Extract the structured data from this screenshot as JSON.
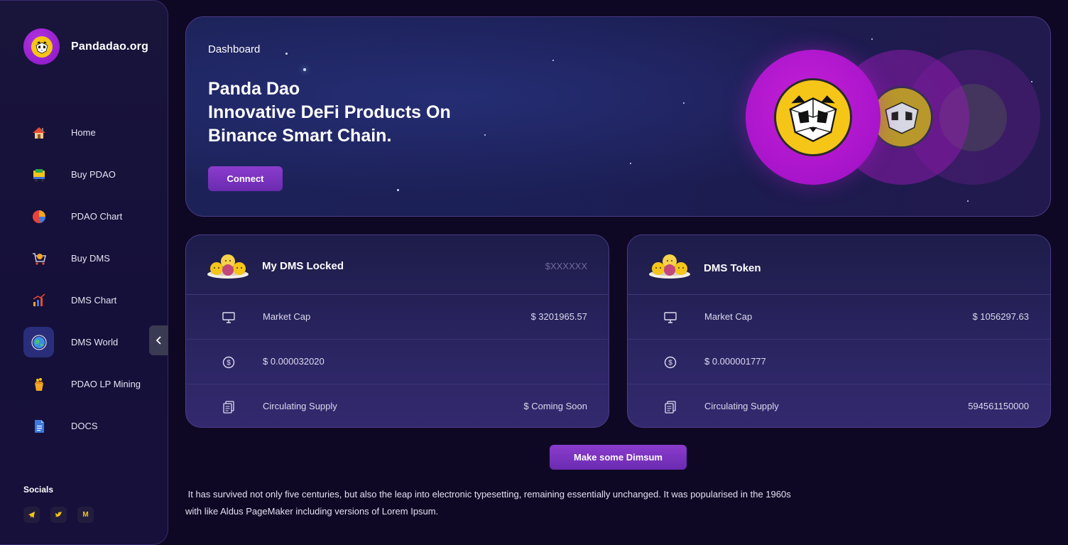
{
  "brand": {
    "name": "Pandadao.org",
    "logo_icon": "panda-logo-icon"
  },
  "sidebar": {
    "items": [
      {
        "label": "Home",
        "icon": "house-icon",
        "active": false
      },
      {
        "label": "Buy PDAO",
        "icon": "shopping-cart-icon",
        "active": false
      },
      {
        "label": "PDAO Chart",
        "icon": "pie-chart-icon",
        "active": false
      },
      {
        "label": "Buy DMS",
        "icon": "cart-icon",
        "active": false
      },
      {
        "label": "DMS Chart",
        "icon": "bar-chart-icon",
        "active": false
      },
      {
        "label": "DMS World",
        "icon": "globe-icon",
        "active": true
      },
      {
        "label": "PDAO LP Mining",
        "icon": "bucket-icon",
        "active": false
      },
      {
        "label": "DOCS",
        "icon": "document-icon",
        "active": false
      }
    ],
    "socials_title": "Socials",
    "socials": [
      {
        "icon": "telegram-icon",
        "glyph": "➤"
      },
      {
        "icon": "twitter-icon",
        "glyph": "🐦"
      },
      {
        "icon": "medium-icon",
        "glyph": "M"
      }
    ]
  },
  "hero": {
    "title": "Dashboard",
    "headline_line1": "Panda Dao",
    "headline_line2": "Innovative DeFi Products On",
    "headline_line3": "Binance Smart Chain.",
    "connect_label": "Connect"
  },
  "cards": {
    "left": {
      "title": "My DMS Locked",
      "head_value": "$XXXXXX",
      "rows": [
        {
          "icon": "monitor-icon",
          "label": "Market Cap",
          "value": "$ 3201965.57"
        },
        {
          "icon": "dollar-icon",
          "label": "$ 0.000032020",
          "value": ""
        },
        {
          "icon": "copy-icon",
          "label": "Circulating Supply",
          "value": "$ Coming Soon"
        }
      ]
    },
    "right": {
      "title": "DMS Token",
      "head_value": "",
      "rows": [
        {
          "icon": "monitor-icon",
          "label": "Market Cap",
          "value": "$ 1056297.63"
        },
        {
          "icon": "dollar-icon",
          "label": "$ 0.000001777",
          "value": ""
        },
        {
          "icon": "copy-icon",
          "label": "Circulating Supply",
          "value": "594561150000"
        }
      ]
    }
  },
  "dimsum_label": "Make some Dimsum",
  "body_text_line1": " It has survived not only five centuries, but also the leap into electronic typesetting, remaining essentially unchanged. It was popularised in the 1960s",
  "body_text_line2": "with like Aldus PageMaker including versions of Lorem Ipsum.",
  "colors": {
    "accent": "#7b34c2",
    "panda_coin": "#f5c518",
    "magenta": "#a014c8",
    "background": "#0f0824"
  }
}
